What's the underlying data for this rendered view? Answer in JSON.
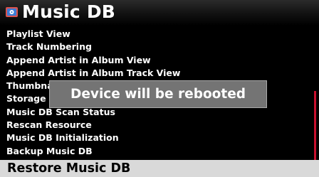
{
  "header": {
    "title": "Music DB",
    "icon": "music-db-icon"
  },
  "menu": {
    "items": [
      {
        "label": "Playlist View"
      },
      {
        "label": "Track Numbering"
      },
      {
        "label": "Append Artist in Album View"
      },
      {
        "label": "Append Artist in Album Track View"
      },
      {
        "label": "Thumbnail"
      },
      {
        "label": "Storage"
      },
      {
        "label": "Music DB Scan Status"
      },
      {
        "label": "Rescan Resource"
      },
      {
        "label": "Music DB Initialization"
      },
      {
        "label": "Backup Music DB"
      }
    ],
    "selected": {
      "label": "Restore Music DB"
    }
  },
  "toast": {
    "message": "Device will be rebooted"
  },
  "colors": {
    "background": "#000000",
    "selection_bg": "#d9d9d9",
    "toast_bg": "#747474",
    "scroll_thumb": "#c8102e"
  }
}
